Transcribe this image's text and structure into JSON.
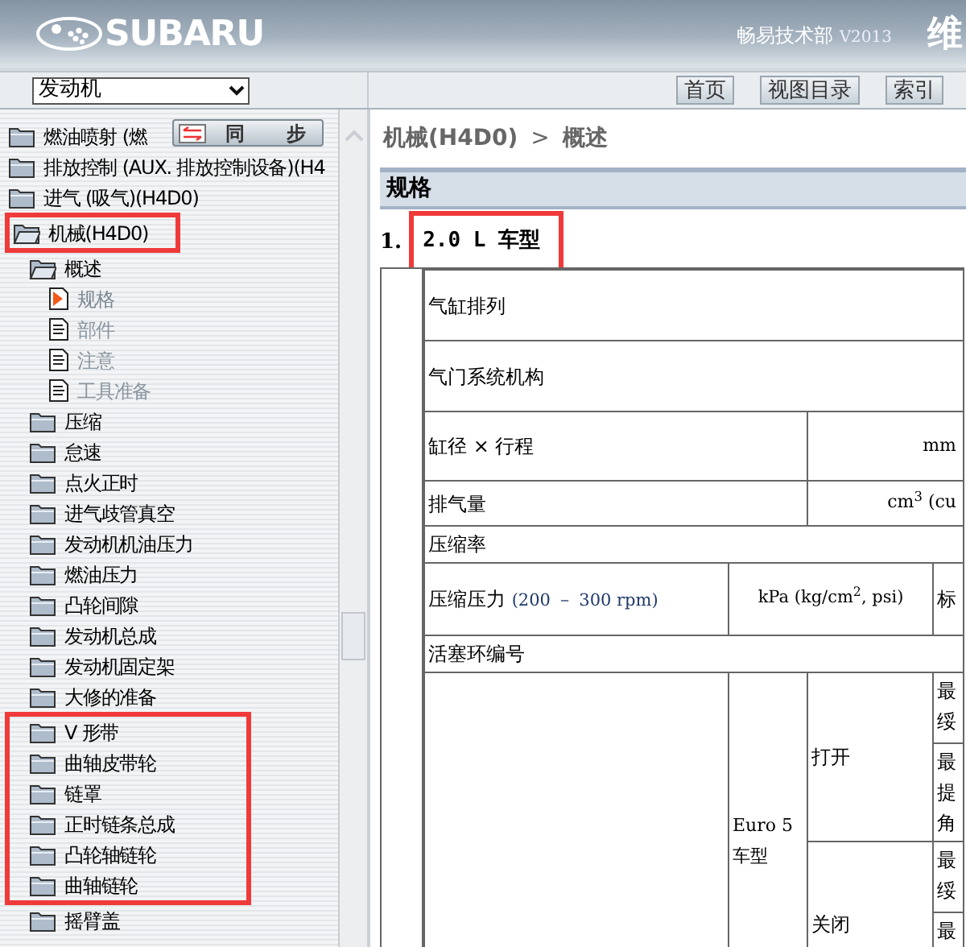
{
  "header": {
    "logo_text": "SUBARU",
    "vendor": "畅易技术部",
    "version": "V2013",
    "title": "维"
  },
  "toolbar": {
    "category_select": {
      "value": "发动机"
    },
    "buttons": [
      {
        "label": "首页"
      },
      {
        "label": "视图目录"
      },
      {
        "label": "索引"
      }
    ]
  },
  "sync_button": {
    "label_1": "同",
    "label_2": "步"
  },
  "tree": [
    {
      "label": "燃油喷射 (燃",
      "kind": "folder",
      "expanded": false,
      "highlighted": false
    },
    {
      "label": "排放控制 (AUX. 排放控制设备)(H4",
      "kind": "folder",
      "expanded": false,
      "highlighted": false
    },
    {
      "label": "进气 (吸气)(H4D0)",
      "kind": "folder",
      "expanded": false,
      "highlighted": false
    },
    {
      "label": "机械(H4D0)",
      "kind": "folder",
      "expanded": true,
      "highlighted": true,
      "children": [
        {
          "label": "概述",
          "kind": "folder",
          "expanded": true,
          "highlighted": false,
          "children": [
            {
              "label": "规格",
              "kind": "page",
              "selected": true,
              "highlighted": false
            },
            {
              "label": "部件",
              "kind": "page",
              "selected": false,
              "highlighted": false
            },
            {
              "label": "注意",
              "kind": "page",
              "selected": false,
              "highlighted": false
            },
            {
              "label": "工具准备",
              "kind": "page",
              "selected": false,
              "highlighted": false
            }
          ]
        },
        {
          "label": "压缩",
          "kind": "folder",
          "expanded": false,
          "highlighted": false
        },
        {
          "label": "怠速",
          "kind": "folder",
          "expanded": false,
          "highlighted": false
        },
        {
          "label": "点火正时",
          "kind": "folder",
          "expanded": false,
          "highlighted": false
        },
        {
          "label": "进气歧管真空",
          "kind": "folder",
          "expanded": false,
          "highlighted": false
        },
        {
          "label": "发动机机油压力",
          "kind": "folder",
          "expanded": false,
          "highlighted": false
        },
        {
          "label": "燃油压力",
          "kind": "folder",
          "expanded": false,
          "highlighted": false
        },
        {
          "label": "凸轮间隙",
          "kind": "folder",
          "expanded": false,
          "highlighted": false
        },
        {
          "label": "发动机总成",
          "kind": "folder",
          "expanded": false,
          "highlighted": false
        },
        {
          "label": "发动机固定架",
          "kind": "folder",
          "expanded": false,
          "highlighted": false
        },
        {
          "label": "大修的准备",
          "kind": "folder",
          "expanded": false,
          "highlighted": false
        },
        {
          "label": "V 形带",
          "kind": "folder",
          "expanded": false,
          "highlighted": true
        },
        {
          "label": "曲轴皮带轮",
          "kind": "folder",
          "expanded": false,
          "highlighted": true
        },
        {
          "label": "链罩",
          "kind": "folder",
          "expanded": false,
          "highlighted": true
        },
        {
          "label": "正时链条总成",
          "kind": "folder",
          "expanded": false,
          "highlighted": true
        },
        {
          "label": "凸轮轴链轮",
          "kind": "folder",
          "expanded": false,
          "highlighted": true
        },
        {
          "label": "曲轴链轮",
          "kind": "folder",
          "expanded": false,
          "highlighted": true
        },
        {
          "label": "摇臂盖",
          "kind": "folder",
          "expanded": false,
          "highlighted": false
        }
      ]
    }
  ],
  "content": {
    "breadcrumb": [
      "机械(H4D0)",
      "概述"
    ],
    "breadcrumb_separator": ">",
    "section_title": "规格",
    "heading": {
      "number": "1.",
      "label": "2.0 L 车型",
      "highlighted": true
    },
    "table": {
      "rows": [
        {
          "kind": "full",
          "label": "气缸排列"
        },
        {
          "kind": "full",
          "label": "气门系统机构"
        },
        {
          "kind": "value",
          "label": "缸径 × 行程",
          "unit": "mm"
        },
        {
          "kind": "value",
          "label": "排气量",
          "unit": "cm$^{3}$ (cu"
        },
        {
          "kind": "short",
          "label": "压缩率"
        },
        {
          "kind": "pressure",
          "label": "压缩压力",
          "condition": "(200 － 300 rpm)",
          "unit": "kPa (kg/cm$^{2}$, psi)",
          "column_4": "标"
        },
        {
          "kind": "short",
          "label": "活塞环编号"
        },
        {
          "kind": "rings",
          "model": "Euro 5 车型",
          "states": [
            {
              "label": "打开",
              "column_4": [
                "最绥",
                "最提角"
              ]
            },
            {
              "label": "关闭",
              "column_4": [
                "最绥",
                "最"
              ]
            }
          ]
        }
      ]
    }
  }
}
